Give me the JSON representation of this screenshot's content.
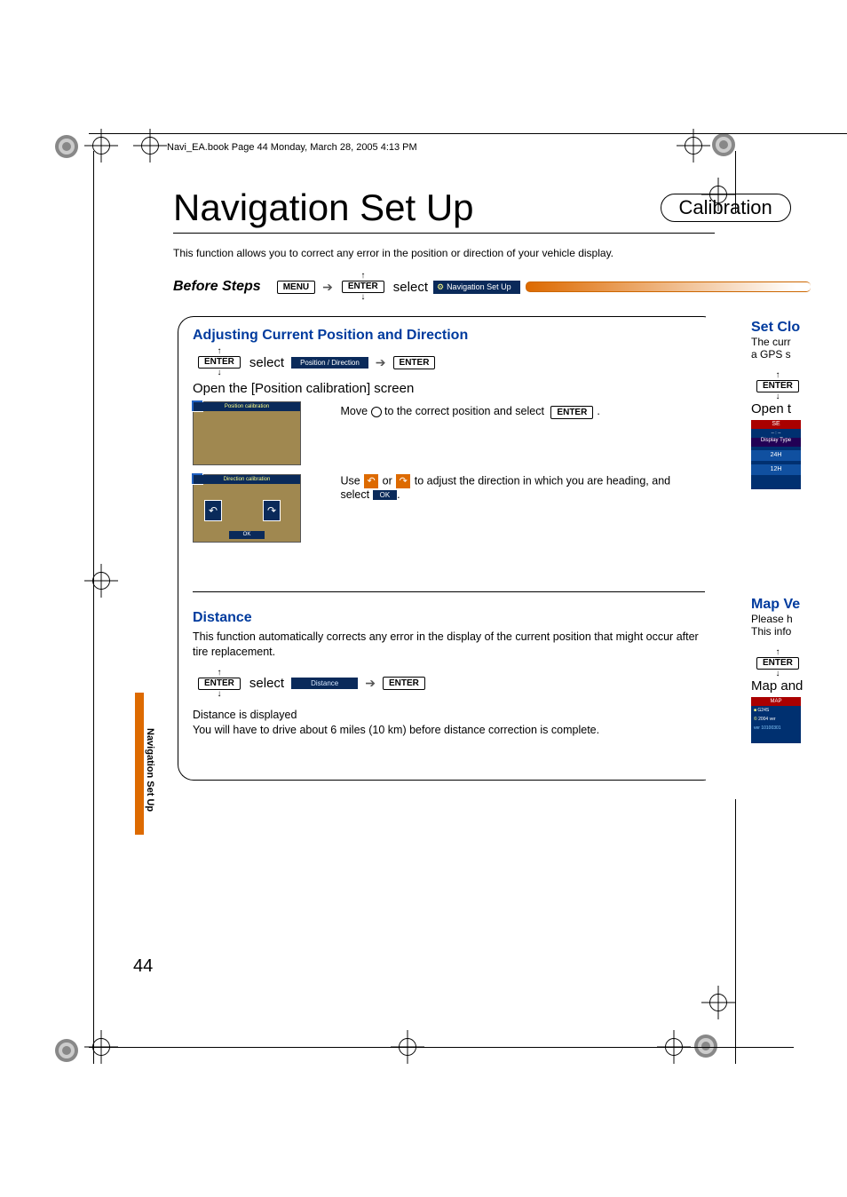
{
  "header": "Navi_EA.book  Page 44  Monday, March 28, 2005  4:13 PM",
  "title": "Navigation Set Up",
  "pill": "Calibration",
  "intro": "This function allows you to correct any error in the position or direction of your vehicle display.",
  "before": {
    "label": "Before Steps",
    "menu": "MENU",
    "enter": "ENTER",
    "select": "select",
    "chip": "Navigation Set Up"
  },
  "section1": {
    "heading": "Adjusting Current Position and Direction",
    "enter": "ENTER",
    "select": "select",
    "posdir": "Position / Direction",
    "open": "Open the [Position calibration] screen",
    "thumb1_caption": "Position calibration",
    "move_a": "Move ",
    "move_b": " to the correct position and select ",
    "thumb2_caption": "Direction calibration",
    "use_a": "Use ",
    "use_or": " or ",
    "use_b": " to adjust the direction in which you are heading, and select ",
    "ok": "OK",
    "period": "."
  },
  "section2": {
    "heading": "Distance",
    "body": "This function automatically corrects any error in the display of the current position that might occur after tire replacement.",
    "enter": "ENTER",
    "select": "select",
    "chip": "Distance",
    "line1": "Distance is displayed",
    "line2": "You will have to drive about 6 miles (10 km) before distance correction is complete."
  },
  "right1": {
    "title": "Set Clo",
    "l1": "The curr",
    "l2": "a GPS s",
    "enter": "ENTER",
    "open": "Open t",
    "hdr": "SE",
    "row1": "Display Type",
    "row2": "24H",
    "row3": "12H"
  },
  "right2": {
    "title": "Map Ve",
    "l1": "Please h",
    "l2": "This info",
    "enter": "ENTER",
    "open": "Map and",
    "hdr": "MAP",
    "r1": "G24S",
    "r2": "2004 ver",
    "r3": "10100301"
  },
  "page_number": "44",
  "side_label": "Navigation Set Up"
}
